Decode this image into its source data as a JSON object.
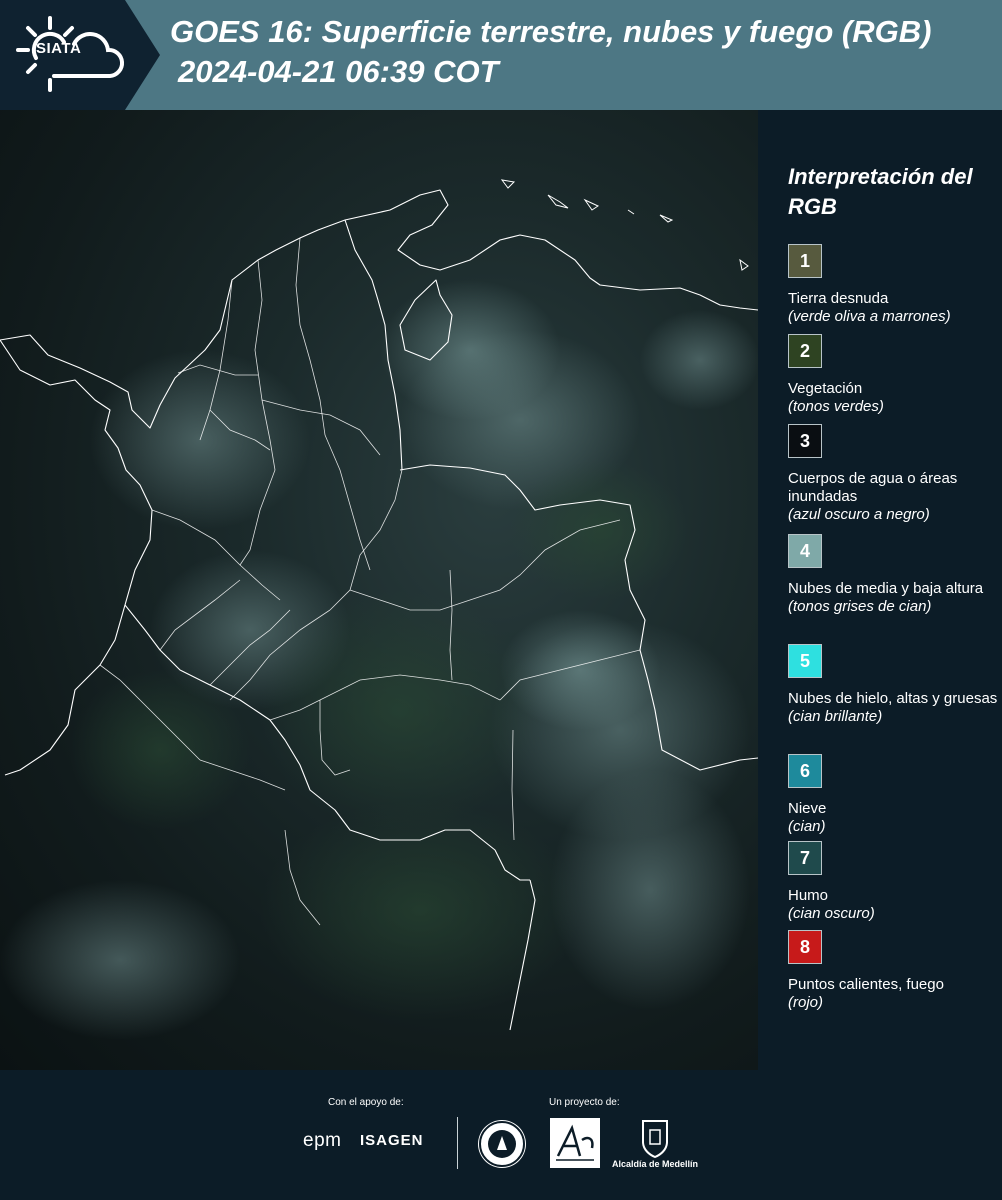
{
  "header": {
    "logo_text": "SIATA",
    "title_line1": "GOES 16: Superficie terrestre, nubes y fuego (RGB)",
    "title_line2": "2024-04-21 06:39 COT"
  },
  "legend": {
    "title": "Interpretación del RGB",
    "items": [
      {
        "num": "1",
        "label": "Tierra desnuda",
        "desc": "(verde oliva a marrones)",
        "color": "#575a3e"
      },
      {
        "num": "2",
        "label": "Vegetación",
        "desc": "(tonos verdes)",
        "color": "#2e4322"
      },
      {
        "num": "3",
        "label": "Cuerpos de agua o áreas inundadas",
        "desc": "(azul oscuro a negro)",
        "color": "#0a0e12"
      },
      {
        "num": "4",
        "label": "Nubes de media y baja altura",
        "desc": "(tonos grises de cian)",
        "color": "#7fa9a8"
      },
      {
        "num": "5",
        "label": "Nubes de hielo, altas y gruesas",
        "desc": "(cian brillante)",
        "color": "#2ee0e0"
      },
      {
        "num": "6",
        "label": "Nieve",
        "desc": "(cian)",
        "color": "#1e8a9c"
      },
      {
        "num": "7",
        "label": "Humo",
        "desc": "(cian oscuro)",
        "color": "#1f4a4c"
      },
      {
        "num": "8",
        "label": "Puntos calientes, fuego",
        "desc": "(rojo)",
        "color": "#c71a1a"
      }
    ]
  },
  "footer": {
    "support_label": "Con el apoyo de:",
    "project_label": "Un proyecto de:",
    "epm": "epm",
    "isagen": "ISAGEN",
    "alcaldia": "Alcaldía de Medellín"
  }
}
